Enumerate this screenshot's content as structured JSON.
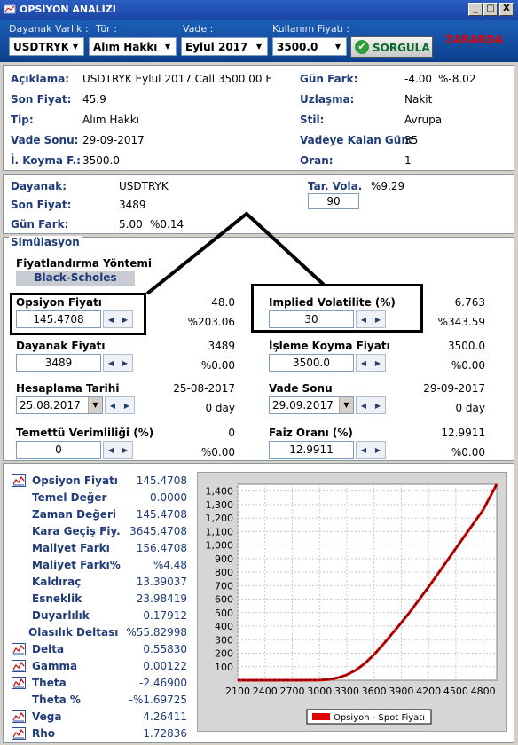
{
  "window": {
    "title": "OPSİYON ANALİZİ",
    "min": "_",
    "max": "□",
    "close": "X"
  },
  "toolbar": {
    "labels": {
      "dayanak": "Dayanak Varlık :",
      "tur": "Tür :",
      "vade": "Vade :",
      "fiyat": "Kullanım Fiyatı :"
    },
    "values": {
      "dayanak": "USDTRYK",
      "tur": "Alım Hakkı",
      "vade": "Eylul 2017",
      "fiyat": "3500.0"
    },
    "query_button": "SORGULA",
    "status": "ZARARDA"
  },
  "info": {
    "aciklama_l": "Açıklama:",
    "aciklama_v": "USDTRYK Eylul 2017 Call 3500.00 E",
    "sonfiyat_l": "Son Fiyat:",
    "sonfiyat_v": "45.9",
    "tip_l": "Tip:",
    "tip_v": "Alım Hakkı",
    "vadesonu_l": "Vade Sonu:",
    "vadesonu_v": "29-09-2017",
    "koyma_l": "İ. Koyma F.:",
    "koyma_v": "3500.0",
    "gunfark_l": "Gün Fark:",
    "gunfark_v1": "-4.00",
    "gunfark_v2": "%-8.02",
    "uzlasma_l": "Uzlaşma:",
    "uzlasma_v": "Nakit",
    "stil_l": "Stil:",
    "stil_v": "Avrupa",
    "kalangun_l": "Vadeye Kalan Gün:",
    "kalangun_v": "35",
    "oran_l": "Oran:",
    "oran_v": "1"
  },
  "underlying": {
    "dayanak_l": "Dayanak:",
    "dayanak_v": "USDTRYK",
    "sonfiyat_l": "Son Fiyat:",
    "sonfiyat_v": "3489",
    "gunfark_l": "Gün Fark:",
    "gunfark_v1": "5.00",
    "gunfark_v2": "%0.14",
    "tarvola_l": "Tar. Vola.",
    "tarvola_v": "%9.29",
    "tarvola_input": "90"
  },
  "sim": {
    "title": "Simülasyon",
    "method_l": "Fiyatlandırma Yöntemi",
    "method_v": "Black-Scholes",
    "opf_l": "Opsiyon Fiyatı",
    "opf_input": "145.4708",
    "opf_r1": "48.0",
    "opf_r2": "%203.06",
    "iv_l": "Implied Volatilite (%)",
    "iv_input": "30",
    "iv_r1": "6.763",
    "iv_r2": "%343.59",
    "df_l": "Dayanak Fiyatı",
    "df_input": "3489",
    "df_r1": "3489",
    "df_r2": "%0.00",
    "ikf_l": "İşleme Koyma Fiyatı",
    "ikf_input": "3500.0",
    "ikf_r1": "3500.0",
    "ikf_r2": "%0.00",
    "ht_l": "Hesaplama Tarihi",
    "ht_input": "25.08.2017",
    "ht_r1": "25-08-2017",
    "ht_r2": "0 day",
    "vs_l": "Vade Sonu",
    "vs_input": "29.09.2017",
    "vs_r1": "29-09-2017",
    "vs_r2": "0 day",
    "tv_l": "Temettü Verimliliği (%)",
    "tv_input": "0",
    "tv_r1": "0",
    "tv_r2": "%0.00",
    "fo_l": "Faiz Oranı (%)",
    "fo_input": "12.9911",
    "fo_r1": "12.9911",
    "fo_r2": "%0.00"
  },
  "greeks": [
    {
      "label": "Opsiyon Fiyatı",
      "value": "145.4708",
      "icon": "chart-icon"
    },
    {
      "label": "Temel Değer",
      "value": "0.0000"
    },
    {
      "label": "Zaman Değeri",
      "value": "145.4708"
    },
    {
      "label": "Kara Geçiş Fiy.",
      "value": "3645.4708"
    },
    {
      "label": "Maliyet Farkı",
      "value": "156.4708"
    },
    {
      "label": "Maliyet Farkı%",
      "value": "%4.48"
    },
    {
      "label": "Kaldıraç",
      "value": "13.39037"
    },
    {
      "label": "Esneklik",
      "value": "23.98419"
    },
    {
      "label": "Duyarlılık",
      "value": "0.17912"
    },
    {
      "label": "Olasılık Deltası",
      "value": "%55.82998"
    },
    {
      "label": "Delta",
      "value": "0.55830",
      "icon": "chart-icon"
    },
    {
      "label": "Gamma",
      "value": "0.00122",
      "icon": "chart-icon"
    },
    {
      "label": "Theta",
      "value": "-2.46900",
      "icon": "chart-icon"
    },
    {
      "label": "Theta %",
      "value": "-%1.69725"
    },
    {
      "label": "Vega",
      "value": "4.26411",
      "icon": "chart-icon"
    },
    {
      "label": "Rho",
      "value": "1.72836",
      "icon": "chart-icon"
    }
  ],
  "chart_data": {
    "type": "line",
    "legend": "Opsiyon - Spot Fiyatı",
    "legend_position": "bottom",
    "color": "#e00000",
    "xticks": [
      "2100",
      "2400",
      "2700",
      "3000",
      "3300",
      "3600",
      "3900",
      "4200",
      "4500",
      "4800"
    ],
    "yticks": [
      "100",
      "200",
      "300",
      "400",
      "500",
      "600",
      "700",
      "800",
      "900",
      "1,000",
      "1,100",
      "1,200",
      "1,300",
      "1,400"
    ],
    "xlim": [
      2100,
      4950
    ],
    "ylim": [
      0,
      1450
    ],
    "grid": true,
    "x": [
      2100,
      2400,
      2700,
      3000,
      3100,
      3200,
      3300,
      3400,
      3500,
      3600,
      3700,
      3800,
      3900,
      4000,
      4200,
      4400,
      4600,
      4800,
      4950
    ],
    "y": [
      0,
      0,
      0,
      1,
      5,
      18,
      40,
      75,
      125,
      190,
      265,
      345,
      425,
      510,
      690,
      880,
      1070,
      1260,
      1450
    ]
  }
}
